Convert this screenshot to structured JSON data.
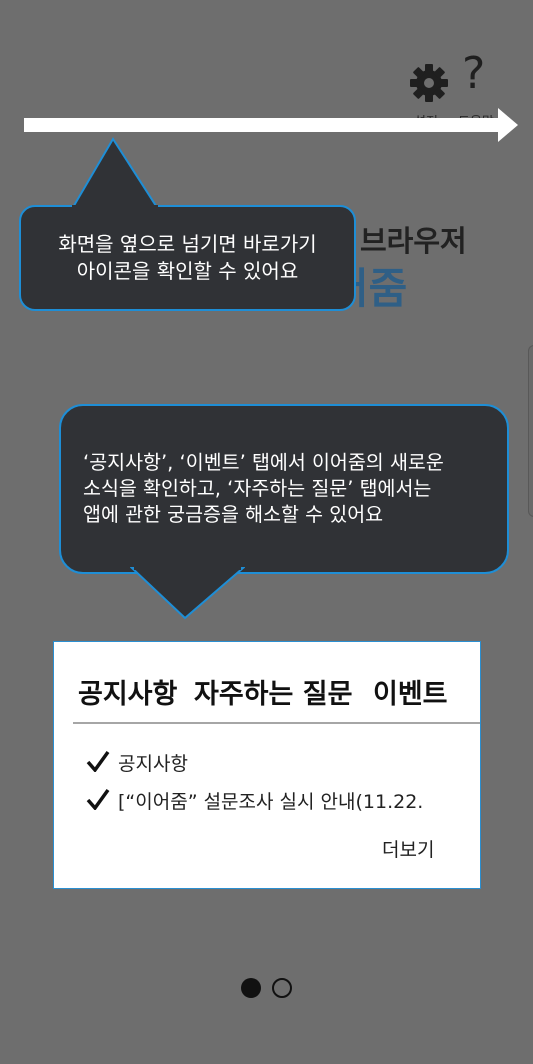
{
  "header": {
    "settings_label": "설정",
    "help_label": "도움말",
    "help_glyph": "?"
  },
  "background": {
    "subtitle": "브라우저",
    "brand": "어줌"
  },
  "tooltips": {
    "swipe": {
      "line1": "화면을 옆으로 넘기면 바로가기",
      "line2": "아이콘을 확인할 수 있어요"
    },
    "tabs_info": {
      "line1": "‘공지사항’, ‘이벤트’ 탭에서 이어줌의 새로운",
      "line2": "소식을  확인하고, ‘자주하는 질문’ 탭에서는",
      "line3": "앱에 관한 궁금증을 해소할 수 있어요"
    }
  },
  "notice_card": {
    "tabs": [
      {
        "label": "공지사항"
      },
      {
        "label": "자주하는 질문"
      },
      {
        "label": "이벤트"
      }
    ],
    "items": [
      {
        "label": "공지사항"
      },
      {
        "label": "[“이어줌” 설문조사 실시 안내(11.22."
      }
    ],
    "more_label": "더보기"
  },
  "pager": {
    "current": 1,
    "total": 2
  },
  "colors": {
    "overlay": "#6e6e6e",
    "tooltip_bg": "#303236",
    "tooltip_border": "#1e8ed6",
    "brand": "#2f5f86"
  },
  "icons": [
    "settings-icon",
    "help-icon",
    "swipe-arrow-icon",
    "check-icon"
  ]
}
